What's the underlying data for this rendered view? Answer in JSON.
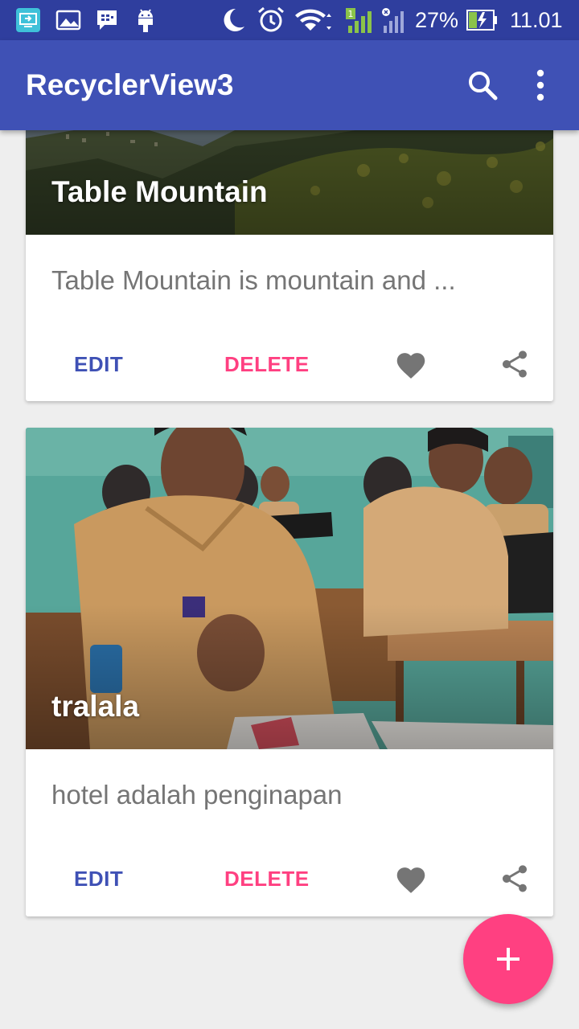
{
  "status_bar": {
    "battery_percent": "27%",
    "time": "11.01",
    "icons": [
      "screen-share-icon",
      "gallery-icon",
      "bbm-icon",
      "android-icon",
      "moon-icon",
      "alarm-icon",
      "wifi-icon",
      "signal-sim1-icon",
      "signal-sim2-icon",
      "battery-charging-icon"
    ]
  },
  "app_bar": {
    "title": "RecyclerView3",
    "actions": [
      "search-icon",
      "overflow-menu-icon"
    ]
  },
  "cards": [
    {
      "title": "Table Mountain",
      "description": "Table Mountain is mountain and ...",
      "edit_label": "EDIT",
      "delete_label": "DELETE",
      "icons": [
        "heart-icon",
        "share-icon"
      ]
    },
    {
      "title": "tralala",
      "description": "hotel adalah penginapan",
      "edit_label": "EDIT",
      "delete_label": "DELETE",
      "icons": [
        "heart-icon",
        "share-icon"
      ]
    }
  ],
  "fab": {
    "icon": "plus-icon"
  },
  "colors": {
    "primary": "#3f51b5",
    "primary_dark": "#2f3e9e",
    "accent": "#ff4081",
    "background": "#eeeeee"
  }
}
